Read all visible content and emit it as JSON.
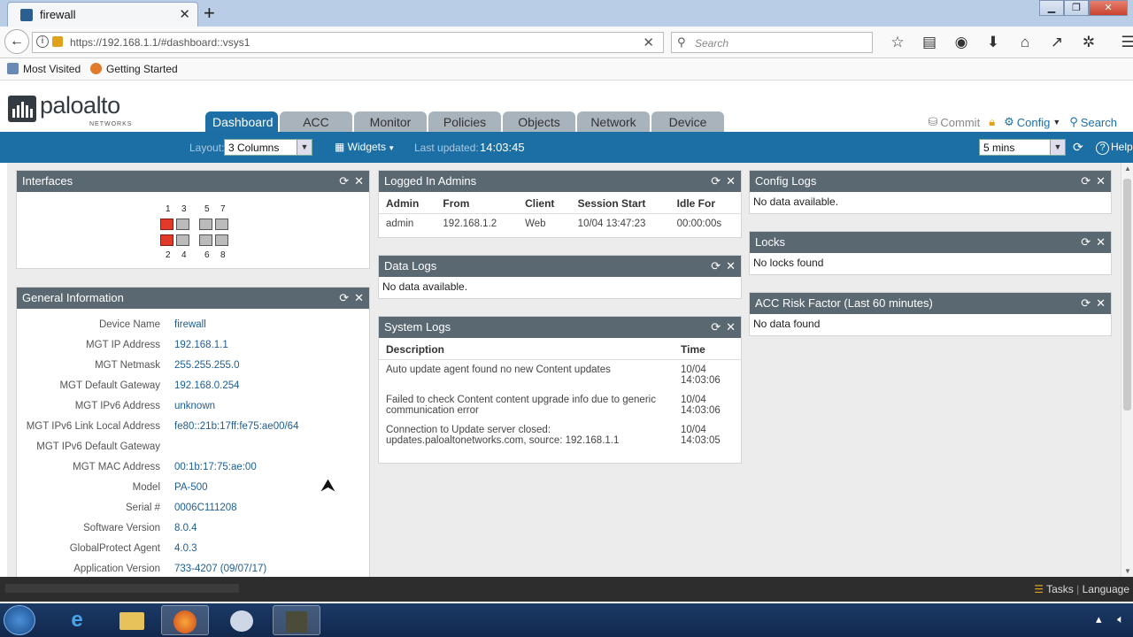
{
  "browser": {
    "tab_title": "firewall",
    "url_host": "https://192.168.1.1",
    "url_rest": "/#dashboard::vsys1",
    "search_placeholder": "Search",
    "bookmarks": [
      "Most Visited",
      "Getting Started"
    ]
  },
  "app": {
    "logo_word": "paloalto",
    "logo_sub": "NETWORKS",
    "tabs": [
      "Dashboard",
      "ACC",
      "Monitor",
      "Policies",
      "Objects",
      "Network",
      "Device"
    ],
    "active_tab": "Dashboard",
    "tools": [
      "Commit",
      "Config",
      "Search"
    ]
  },
  "toolbar": {
    "layout_label": "Layout:",
    "layout_value": "3 Columns",
    "widgets_label": "Widgets",
    "last_updated_label": "Last updated:",
    "last_updated_value": "14:03:45",
    "refresh_value": "5 mins",
    "help_label": "Help"
  },
  "widgets": {
    "interfaces": {
      "title": "Interfaces",
      "top_numbers": [
        "1",
        "3",
        "5",
        "7"
      ],
      "bottom_numbers": [
        "2",
        "4",
        "6",
        "8"
      ]
    },
    "general": {
      "title": "General Information",
      "rows": [
        {
          "k": "Device Name",
          "v": "firewall"
        },
        {
          "k": "MGT IP Address",
          "v": "192.168.1.1"
        },
        {
          "k": "MGT Netmask",
          "v": "255.255.255.0"
        },
        {
          "k": "MGT Default Gateway",
          "v": "192.168.0.254"
        },
        {
          "k": "MGT IPv6 Address",
          "v": "unknown"
        },
        {
          "k": "MGT IPv6 Link Local Address",
          "v": "fe80::21b:17ff:fe75:ae00/64"
        },
        {
          "k": "MGT IPv6 Default Gateway",
          "v": ""
        },
        {
          "k": "MGT MAC Address",
          "v": "00:1b:17:75:ae:00"
        },
        {
          "k": "Model",
          "v": "PA-500"
        },
        {
          "k": "Serial #",
          "v": "0006C111208"
        },
        {
          "k": "Software Version",
          "v": "8.0.4"
        },
        {
          "k": "GlobalProtect Agent",
          "v": "4.0.3"
        },
        {
          "k": "Application Version",
          "v": "733-4207 (09/07/17)"
        }
      ]
    },
    "admins": {
      "title": "Logged In Admins",
      "headers": [
        "Admin",
        "From",
        "Client",
        "Session Start",
        "Idle For"
      ],
      "rows": [
        [
          "admin",
          "192.168.1.2",
          "Web",
          "10/04 13:47:23",
          "00:00:00s"
        ]
      ]
    },
    "data_logs": {
      "title": "Data Logs",
      "message": "No data available."
    },
    "system_logs": {
      "title": "System Logs",
      "headers": [
        "Description",
        "Time"
      ],
      "rows": [
        {
          "desc": "Auto update agent found no new Content updates",
          "date": "10/04",
          "time": "14:03:06"
        },
        {
          "desc": "Failed to check Content content upgrade info due to generic communication error",
          "date": "10/04",
          "time": "14:03:06"
        },
        {
          "desc": "Connection to Update server closed: updates.paloaltonetworks.com, source: 192.168.1.1",
          "date": "10/04",
          "time": "14:03:05"
        }
      ]
    },
    "config_logs": {
      "title": "Config Logs",
      "message": "No data available."
    },
    "locks": {
      "title": "Locks",
      "message": "No locks found"
    },
    "acc_risk": {
      "title": "ACC Risk Factor (Last 60 minutes)",
      "message": "No data found"
    }
  },
  "statusbar": {
    "tasks": "Tasks",
    "language": "Language"
  },
  "colors": {
    "brand_blue": "#1c6fa5",
    "widget_header": "#5a6872",
    "port_up": "#e23a2a"
  }
}
